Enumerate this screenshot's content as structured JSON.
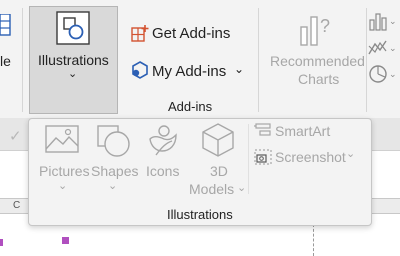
{
  "ribbon": {
    "partial_left_label": "le",
    "illustrations_label": "Illustrations",
    "get_addins_label": "Get Add-ins",
    "my_addins_label": "My Add-ins",
    "addins_group_label": "Add-ins",
    "recommended_line1": "Recommended",
    "recommended_line2": "Charts"
  },
  "popup": {
    "pictures_label": "Pictures",
    "shapes_label": "Shapes",
    "icons_label": "Icons",
    "models_line1": "3D",
    "models_line2": "Models",
    "smartart_label": "SmartArt",
    "screenshot_label": "Screenshot",
    "group_label": "Illustrations"
  },
  "sheet": {
    "column_letter": "C"
  },
  "colors": {
    "orange": "#d35230",
    "blue": "#2b5fb4",
    "disabled": "#a7a7a7",
    "magenta": "#b04fbf"
  }
}
